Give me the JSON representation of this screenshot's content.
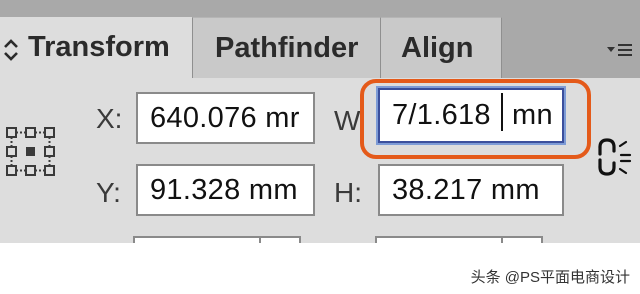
{
  "tabs": [
    {
      "label": "Transform",
      "active": true
    },
    {
      "label": "Pathfinder",
      "active": false
    },
    {
      "label": "Align",
      "active": false
    }
  ],
  "fields": {
    "x": {
      "label": "X:",
      "value": "640.076 mr"
    },
    "y": {
      "label": "Y:",
      "value": "91.328 mm"
    },
    "w": {
      "label": "W",
      "value_left": "7/1.618",
      "value_right": "mn"
    },
    "h": {
      "label": "H:",
      "value": "38.217 mm"
    }
  },
  "icons": {
    "tab_chevron": "up-down-chevron-icon",
    "panel_menu": "panel-menu-icon",
    "reference_point": "reference-point-grid-icon",
    "constrain": "link-proportions-icon"
  },
  "colors": {
    "highlight": "#e45a1a",
    "focus_ring": "#7d9bd6",
    "panel_bg": "#dddddd",
    "tabbar_bg": "#a9a9a9"
  },
  "watermark": "头条 @PS平面电商设计"
}
